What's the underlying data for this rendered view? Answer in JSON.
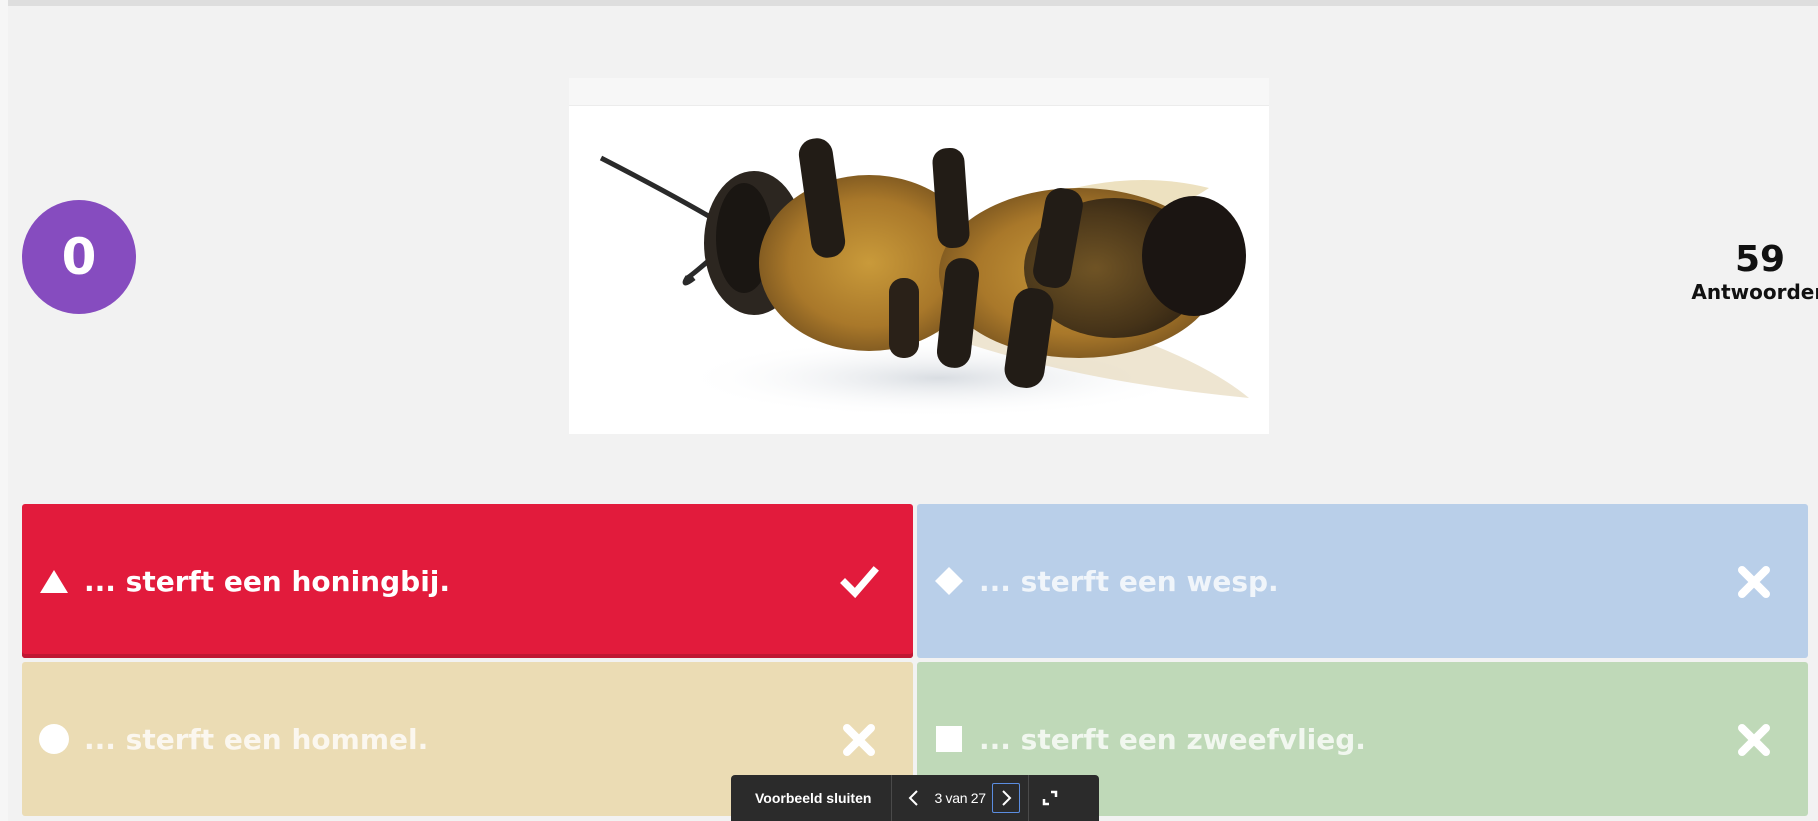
{
  "answer_counter": "0",
  "answers_summary": {
    "count": "59",
    "label": "Antwoorden"
  },
  "answers": [
    {
      "shape": "triangle-icon",
      "text": "... sterft een honingbij.",
      "mark": "check-icon",
      "color": "#e21b3c",
      "correct": true
    },
    {
      "shape": "diamond-icon",
      "text": "... sterft een wesp.",
      "mark": "cross-icon",
      "color": "#b9cfe9",
      "correct": false
    },
    {
      "shape": "circle-icon",
      "text": "... sterft een hommel.",
      "mark": "cross-icon",
      "color": "#ebdcb4",
      "correct": false
    },
    {
      "shape": "square-icon",
      "text": "... sterft een zweefvlieg.",
      "mark": "cross-icon",
      "color": "#bfd9b8",
      "correct": false
    }
  ],
  "preview_bar": {
    "close_label": "Voorbeeld sluiten",
    "page_indicator": "3 van 27"
  },
  "accent_color": "#864cbf"
}
